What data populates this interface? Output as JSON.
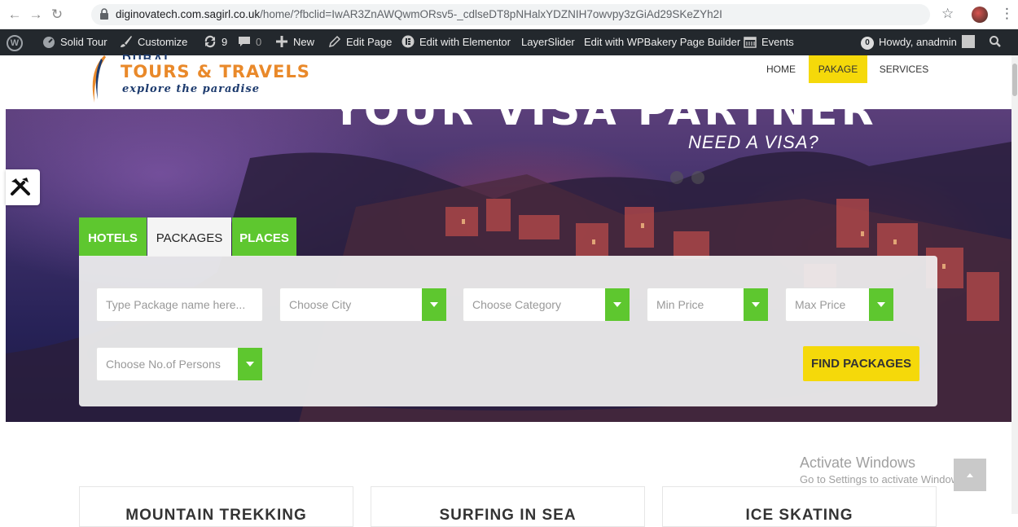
{
  "browser": {
    "url_host": "diginovatech.com.sagirl.co.uk",
    "url_path": "/home/?fbclid=IwAR3ZnAWQwmORsv5-_cdlseDT8pNHalxYDZNIH7owvpy3zGiAd29SKeZYh2I"
  },
  "adminbar": {
    "site_name": "Solid Tour",
    "customize": "Customize",
    "updates_count": "9",
    "comments_count": "0",
    "new": "New",
    "edit_page": "Edit Page",
    "edit_elementor": "Edit with Elementor",
    "layerslider": "LayerSlider",
    "edit_wpbakery": "Edit with WPBakery Page Builder",
    "events": "Events",
    "notif_count": "0",
    "howdy": "Howdy, anadmin"
  },
  "logo": {
    "top": "DUBAI",
    "main": "TOURS & TRAVELS",
    "tagline": "explore the paradise"
  },
  "menu": {
    "home": "HOME",
    "package": "PAKAGE",
    "services": "SERVICES"
  },
  "hero": {
    "title": "YOUR VISA PARTNER",
    "subtitle": "NEED A VISA?"
  },
  "tabs": {
    "hotels": "HOTELS",
    "packages": "PACKAGES",
    "places": "PLACES"
  },
  "search": {
    "package_name_placeholder": "Type Package name here...",
    "city": "Choose City",
    "category": "Choose Category",
    "min_price": "Min Price",
    "max_price": "Max Price",
    "persons": "Choose No.of Persons",
    "find_button": "FIND PACKAGES"
  },
  "activation": {
    "line1": "Activate Windows",
    "line2": "Go to Settings to activate Windows."
  },
  "cards": [
    "MOUNTAIN TREKKING",
    "SURFING IN SEA",
    "ICE SKATING"
  ],
  "colors": {
    "green": "#5ec72f",
    "yellow": "#f5d90a",
    "adminbar": "#23282d"
  }
}
